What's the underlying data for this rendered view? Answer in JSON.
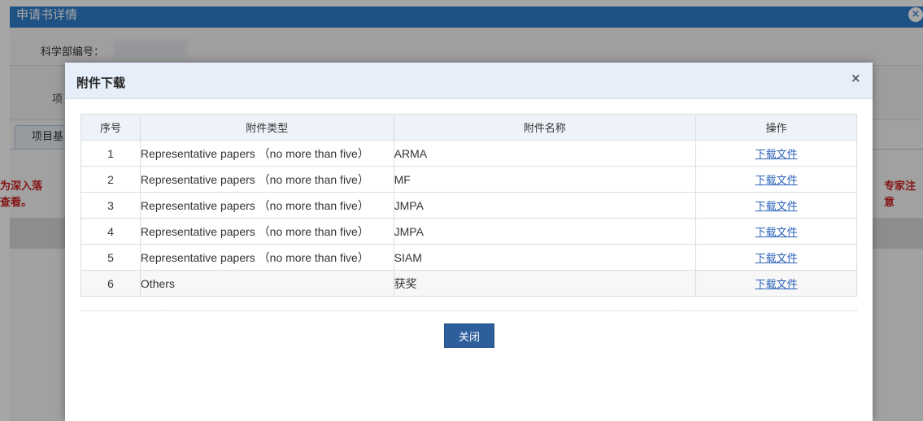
{
  "background": {
    "window_title": "申请书详情",
    "close_icon": "×",
    "code_label": "科学部编号：",
    "row2_label": "项",
    "tab_label": "项目基",
    "notice_left": "为深入落\n查看。",
    "notice_right": "专家注意"
  },
  "modal": {
    "title": "附件下载",
    "close_icon": "×",
    "columns": [
      "序号",
      "附件类型",
      "附件名称",
      "操作"
    ],
    "rows": [
      {
        "index": "1",
        "type": "Representative papers （no more than five）",
        "name": "ARMA",
        "action": "下载文件"
      },
      {
        "index": "2",
        "type": "Representative papers （no more than five）",
        "name": "MF",
        "action": "下载文件"
      },
      {
        "index": "3",
        "type": "Representative papers （no more than five）",
        "name": "JMPA",
        "action": "下载文件"
      },
      {
        "index": "4",
        "type": "Representative papers （no more than five）",
        "name": "JMPA",
        "action": "下载文件"
      },
      {
        "index": "5",
        "type": "Representative papers （no more than five）",
        "name": "SIAM",
        "action": "下载文件"
      },
      {
        "index": "6",
        "type": "Others",
        "name": "获奖",
        "action": "下载文件"
      }
    ],
    "close_button": "关闭"
  }
}
